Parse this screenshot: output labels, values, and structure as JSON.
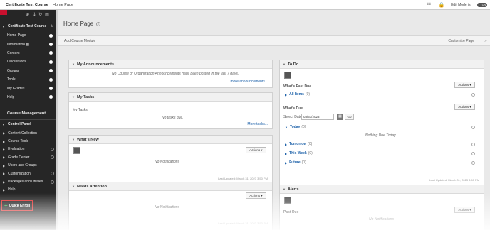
{
  "topbar": {
    "course": "Certificate Test Course",
    "crumb": "Home Page",
    "edit_mode": "Edit Mode is:",
    "toggle": "ON",
    "icons": [
      "ellipsis-icon",
      "lock-icon"
    ]
  },
  "sidebar": {
    "icons": [
      "⊕",
      "⇅",
      "↻",
      "▤"
    ],
    "course_title": "Certificate Test Course",
    "items": [
      {
        "label": "Home Page"
      },
      {
        "label": "Information ▦"
      },
      {
        "label": "Content"
      },
      {
        "label": "Discussions"
      },
      {
        "label": "Groups"
      },
      {
        "label": "Tools"
      },
      {
        "label": "My Grades"
      },
      {
        "label": "Help"
      }
    ],
    "course_management": "Course Management",
    "control_panel": "Control Panel",
    "tools": [
      {
        "label": "Content Collection"
      },
      {
        "label": "Course Tools"
      },
      {
        "label": "Evaluation"
      },
      {
        "label": "Grade Center"
      },
      {
        "label": "Users and Groups"
      },
      {
        "label": "Customization"
      },
      {
        "label": "Packages and Utilities"
      },
      {
        "label": "Help"
      }
    ],
    "quick_enroll": "Quick Enroll"
  },
  "main": {
    "page_title": "Home Page",
    "add_module": "Add Course Module",
    "customize": "Customize Page",
    "announcements": {
      "title": "My Announcements",
      "empty": "No Course or Organization Announcements have been posted in the last 7 days.",
      "more": "more announcements..."
    },
    "tasks": {
      "title": "My Tasks",
      "label": "My Tasks:",
      "empty": "No tasks due.",
      "more": "More tasks..."
    },
    "whats_new": {
      "title": "What's New",
      "actions": "Actions",
      "empty": "No Notifications",
      "updated": "Last Updated: March 31, 2023 3:50 PM"
    },
    "needs_attention": {
      "title": "Needs Attention",
      "actions": "Actions",
      "empty": "No Notifications",
      "updated": "Last Updated: March 31, 2023 3:50 PM"
    },
    "todo": {
      "title": "To Do",
      "past_due": "What's Past Due",
      "actions": "Actions",
      "all_items": "All Items",
      "all_count": "(0)",
      "whats_due": "What's Due",
      "select_date": "Select Date:",
      "date": "03/31/2023",
      "go": "Go",
      "today": "Today",
      "today_count": "(0)",
      "nothing": "Nothing Due Today",
      "tomorrow": "Tomorrow",
      "tomorrow_count": "(0)",
      "this_week": "This Week",
      "week_count": "(0)",
      "future": "Future",
      "future_count": "(0)",
      "updated": "Last Updated: March 31, 2023 3:50 PM"
    },
    "alerts": {
      "title": "Alerts",
      "past_due": "Past Due",
      "actions": "Actions",
      "empty": "No Notifications"
    }
  }
}
